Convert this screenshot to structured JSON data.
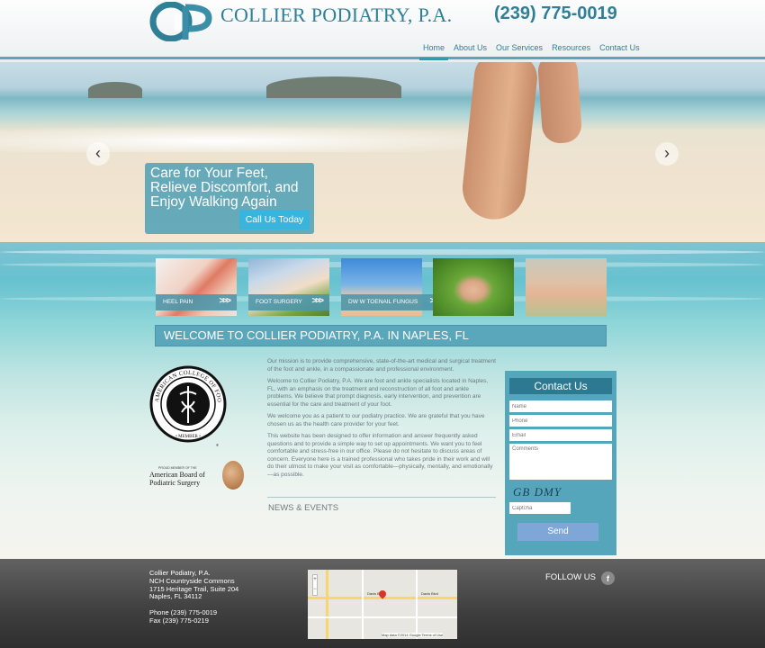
{
  "header": {
    "brand": "COLLIER PODIATRY, P.A.",
    "phone": "(239) 775-0019",
    "logo_text": "CP"
  },
  "nav": [
    {
      "label": "Home",
      "active": true
    },
    {
      "label": "About Us",
      "active": false
    },
    {
      "label": "Our Services",
      "active": false
    },
    {
      "label": "Resources",
      "active": false
    },
    {
      "label": "Contact Us",
      "active": false
    }
  ],
  "hero": {
    "caption": "Care for Your Feet, Relieve Discomfort, and Enjoy Walking Again",
    "cta_label": "Call Us Today",
    "prev_icon": "‹",
    "next_icon": "›"
  },
  "thumbnails": [
    {
      "label": "HEEL PAIN"
    },
    {
      "label": "FOOT SURGERY"
    },
    {
      "label": "DW W TOENAIL FUNGUS"
    },
    {
      "label": ""
    },
    {
      "label": ""
    }
  ],
  "welcome_title": "WELCOME TO COLLIER PODIATRY, P.A. IN NAPLES, FL",
  "content": {
    "paragraphs": [
      "Our mission is to provide comprehensive, state-of-the-art medical and surgical treatment of the foot and ankle, in a compassionate and professional environment.",
      "Welcome to Collier Podiatry, P.A. We are foot and ankle specialists located in Naples, FL, with an emphasis on the treatment and reconstruction of all foot and ankle problems. We believe that prompt diagnosis, early intervention, and prevention are essential for the care and treatment of your foot.",
      "We welcome you as a patient to our podiatry practice. We are grateful that you have chosen us as the health care provider for your feet.",
      "This website has been designed to offer information and answer frequently asked questions and to provide a simple way to set up appointments. We want you to feel comfortable and stress-free in our office. Please do not hesitate to discuss areas of concern. Everyone here is a trained professional who takes pride in their work and will do their utmost to make your visit as comfortable—physically, mentally, and emotionally—as possible."
    ],
    "news_heading": "NEWS & EVENTS"
  },
  "seals": {
    "acfas_text": "AMERICAN COLLEGE OF FOOT AND ANKLE SURGEONS",
    "acfas_member": "MEMBER",
    "abps_small": "PROUD MEMBER OF THE",
    "abps_line1": "American Board of",
    "abps_line2": "Podiatric Surgery"
  },
  "contact_form": {
    "title": "Contact Us",
    "name_placeholder": "Name",
    "phone_placeholder": "Phone",
    "email_placeholder": "Email",
    "comments_placeholder": "Comments",
    "captcha_image_text": "GB DMY",
    "captcha_placeholder": "Captcha",
    "send_label": "Send"
  },
  "footer": {
    "address_lines": [
      "Collier Podiatry, P.A.",
      "NCH Countryside Commons",
      "1715 Heritage Trail, Suite 204",
      "Naples, FL 34112"
    ],
    "phone_line": "Phone (239) 775-0019",
    "fax_line": "Fax (239) 775-0219",
    "map_credit": "Map data ©2014 Google   Terms of Use",
    "map_labels": [
      "Davis Blvd",
      "Davis Blvd"
    ],
    "follow_label": "FOLLOW US",
    "facebook_icon": "f"
  },
  "colors": {
    "brand": "#2f7f97",
    "accent": "#56a6bb",
    "button": "#39b5dd",
    "send": "#7ea7d8"
  }
}
